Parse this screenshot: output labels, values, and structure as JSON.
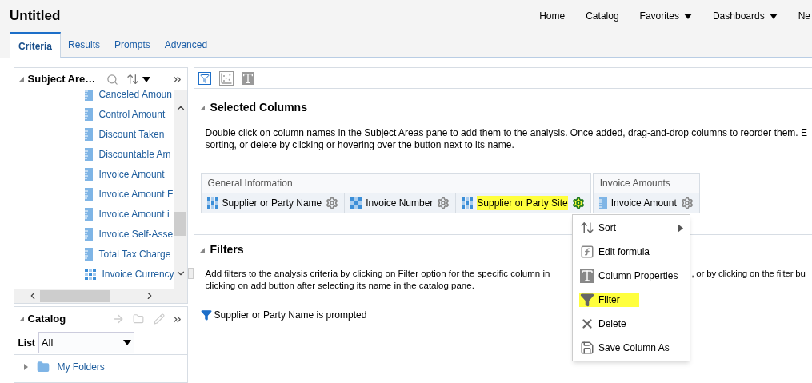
{
  "header": {
    "title": "Untitled",
    "nav": [
      {
        "label": "Home",
        "dropdown": false
      },
      {
        "label": "Catalog",
        "dropdown": false
      },
      {
        "label": "Favorites",
        "dropdown": true
      },
      {
        "label": "Dashboards",
        "dropdown": true
      },
      {
        "label": "Ne",
        "dropdown": false
      }
    ]
  },
  "tabs": [
    {
      "label": "Criteria",
      "selected": true
    },
    {
      "label": "Results",
      "selected": false
    },
    {
      "label": "Prompts",
      "selected": false
    },
    {
      "label": "Advanced",
      "selected": false
    }
  ],
  "subject_areas": {
    "title": "Subject Are…",
    "items": [
      {
        "label": "Canceled Amoun",
        "kind": "measure"
      },
      {
        "label": "Control Amount",
        "kind": "measure"
      },
      {
        "label": "Discount Taken",
        "kind": "measure"
      },
      {
        "label": "Discountable Am",
        "kind": "measure"
      },
      {
        "label": "Invoice Amount",
        "kind": "measure"
      },
      {
        "label": "Invoice Amount F",
        "kind": "measure"
      },
      {
        "label": "Invoice Amount i",
        "kind": "measure"
      },
      {
        "label": "Invoice Self-Asse",
        "kind": "measure"
      },
      {
        "label": "Total Tax Charge",
        "kind": "measure"
      },
      {
        "label": "Invoice Currency",
        "kind": "attribute"
      }
    ]
  },
  "catalog": {
    "title": "Catalog",
    "list_label": "List",
    "list_value": "All",
    "folders": [
      {
        "label": "My Folders",
        "expanded": false
      }
    ]
  },
  "selected_columns": {
    "title": "Selected Columns",
    "description": "Double click on column names in the Subject Areas pane to add them to the analysis. Once added, drag-and-drop columns to reorder them. E",
    "description_2": "sorting, or delete by clicking or hovering over the button next to its name.",
    "groups": [
      {
        "name": "General Information",
        "columns": [
          {
            "label": "Supplier or Party Name",
            "kind": "attribute",
            "highlighted": false
          },
          {
            "label": "Invoice Number",
            "kind": "attribute",
            "highlighted": false
          },
          {
            "label": "Supplier or Party Site",
            "kind": "attribute",
            "highlighted": true
          }
        ]
      },
      {
        "name": "Invoice Amounts",
        "columns": [
          {
            "label": "Invoice Amount",
            "kind": "measure",
            "highlighted": false
          }
        ]
      }
    ]
  },
  "filters": {
    "title": "Filters",
    "description_left": "Add filters to the analysis criteria by clicking on Filter option for the specific column in",
    "description_right": ", or by clicking on the filter bu",
    "description_2": "clicking on add button after selecting its name in the catalog pane.",
    "items": [
      "Supplier or Party Name is prompted"
    ]
  },
  "context_menu": [
    {
      "label": "Sort",
      "kind": "sort",
      "submenu": true,
      "highlighted": false
    },
    {
      "label": "Edit formula",
      "kind": "formula",
      "submenu": false,
      "highlighted": false
    },
    {
      "label": "Column Properties",
      "kind": "properties",
      "submenu": false,
      "highlighted": false
    },
    {
      "label": "Filter",
      "kind": "filter",
      "submenu": false,
      "highlighted": true
    },
    {
      "label": "Delete",
      "kind": "delete",
      "submenu": false,
      "highlighted": false
    },
    {
      "label": "Save Column As",
      "kind": "save",
      "submenu": false,
      "highlighted": false
    }
  ]
}
